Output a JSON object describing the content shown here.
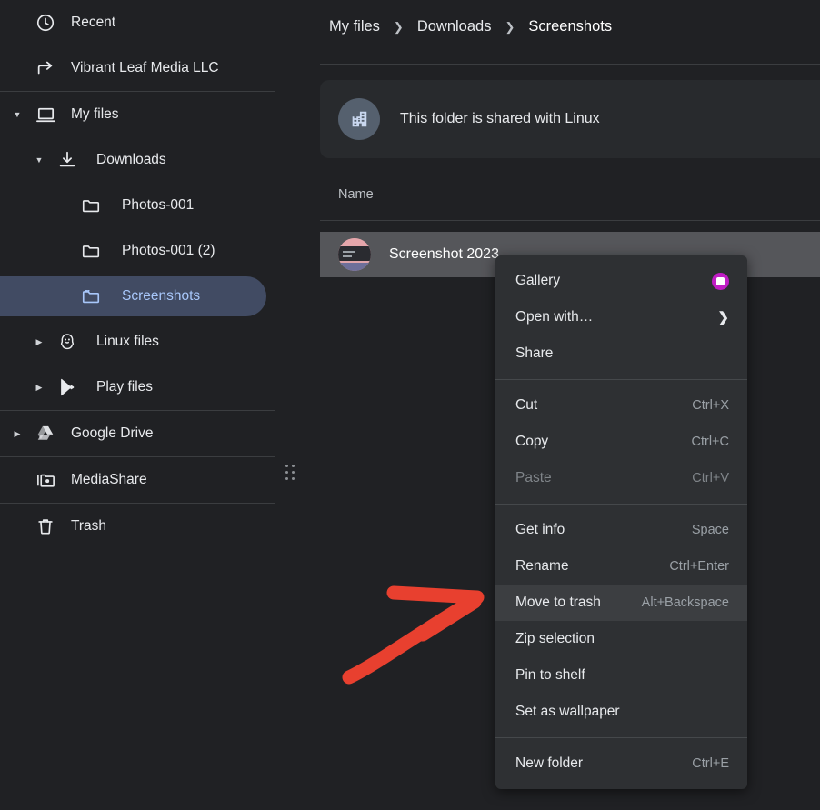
{
  "window": {
    "title": "Files",
    "bg_color": "#202124",
    "accent_selected": "#414b63",
    "accent_text": "#a8c7fa",
    "annotation_color": "#e8402f"
  },
  "sidebar": {
    "items": [
      {
        "label": "Recent",
        "icon": "clock-icon",
        "indent": 0,
        "twisty": "",
        "selected": false
      },
      {
        "label": "Vibrant Leaf Media LLC",
        "icon": "share-arrow-icon",
        "indent": 0,
        "twisty": "",
        "selected": false
      },
      {
        "label": "My files",
        "icon": "laptop-icon",
        "indent": 0,
        "twisty": "expanded",
        "selected": false
      },
      {
        "label": "Downloads",
        "icon": "download-icon",
        "indent": 1,
        "twisty": "expanded",
        "selected": false
      },
      {
        "label": "Photos-001",
        "icon": "folder-icon",
        "indent": 2,
        "twisty": "",
        "selected": false
      },
      {
        "label": "Photos-001 (2)",
        "icon": "folder-icon",
        "indent": 2,
        "twisty": "",
        "selected": false
      },
      {
        "label": "Screenshots",
        "icon": "folder-icon",
        "indent": 2,
        "twisty": "",
        "selected": true
      },
      {
        "label": "Linux files",
        "icon": "linux-penguin-icon",
        "indent": 1,
        "twisty": "collapsed",
        "selected": false
      },
      {
        "label": "Play files",
        "icon": "google-play-icon",
        "indent": 1,
        "twisty": "collapsed",
        "selected": false
      },
      {
        "label": "Google Drive",
        "icon": "google-drive-icon",
        "indent": 0,
        "twisty": "collapsed",
        "selected": false
      },
      {
        "label": "MediaShare",
        "icon": "media-share-icon",
        "indent": 0,
        "twisty": "",
        "selected": false
      },
      {
        "label": "Trash",
        "icon": "trash-icon",
        "indent": 0,
        "twisty": "",
        "selected": false
      }
    ]
  },
  "breadcrumb": {
    "crumbs": [
      {
        "label": "My files"
      },
      {
        "label": "Downloads"
      },
      {
        "label": "Screenshots"
      }
    ],
    "separator": "›"
  },
  "banner": {
    "icon": "shared-folder-building-icon",
    "text": "This folder is shared with Linux"
  },
  "file_list": {
    "columns": [
      "Name"
    ],
    "rows": [
      {
        "name": "Screenshot 2023",
        "icon": "image-thumbnail",
        "selected": true
      }
    ]
  },
  "context_menu": {
    "groups": [
      {
        "items": [
          {
            "label": "Gallery",
            "accel": "",
            "trailing": "app-badge",
            "disabled": false,
            "highlight": false
          },
          {
            "label": "Open with…",
            "accel": "",
            "trailing": "chevron-right",
            "disabled": false,
            "highlight": false
          },
          {
            "label": "Share",
            "accel": "",
            "trailing": "",
            "disabled": false,
            "highlight": false
          }
        ]
      },
      {
        "items": [
          {
            "label": "Cut",
            "accel": "Ctrl+X",
            "trailing": "",
            "disabled": false,
            "highlight": false
          },
          {
            "label": "Copy",
            "accel": "Ctrl+C",
            "trailing": "",
            "disabled": false,
            "highlight": false
          },
          {
            "label": "Paste",
            "accel": "Ctrl+V",
            "trailing": "",
            "disabled": true,
            "highlight": false
          }
        ]
      },
      {
        "items": [
          {
            "label": "Get info",
            "accel": "Space",
            "trailing": "",
            "disabled": false,
            "highlight": false
          },
          {
            "label": "Rename",
            "accel": "Ctrl+Enter",
            "trailing": "",
            "disabled": false,
            "highlight": false
          },
          {
            "label": "Move to trash",
            "accel": "Alt+Backspace",
            "trailing": "",
            "disabled": false,
            "highlight": true
          },
          {
            "label": "Zip selection",
            "accel": "",
            "trailing": "",
            "disabled": false,
            "highlight": false
          },
          {
            "label": "Pin to shelf",
            "accel": "",
            "trailing": "",
            "disabled": false,
            "highlight": false
          },
          {
            "label": "Set as wallpaper",
            "accel": "",
            "trailing": "",
            "disabled": false,
            "highlight": false
          }
        ]
      },
      {
        "items": [
          {
            "label": "New folder",
            "accel": "Ctrl+E",
            "trailing": "",
            "disabled": false,
            "highlight": false
          }
        ]
      }
    ]
  },
  "annotation": {
    "type": "hand-drawn-arrow",
    "points_to": "Move to trash"
  }
}
